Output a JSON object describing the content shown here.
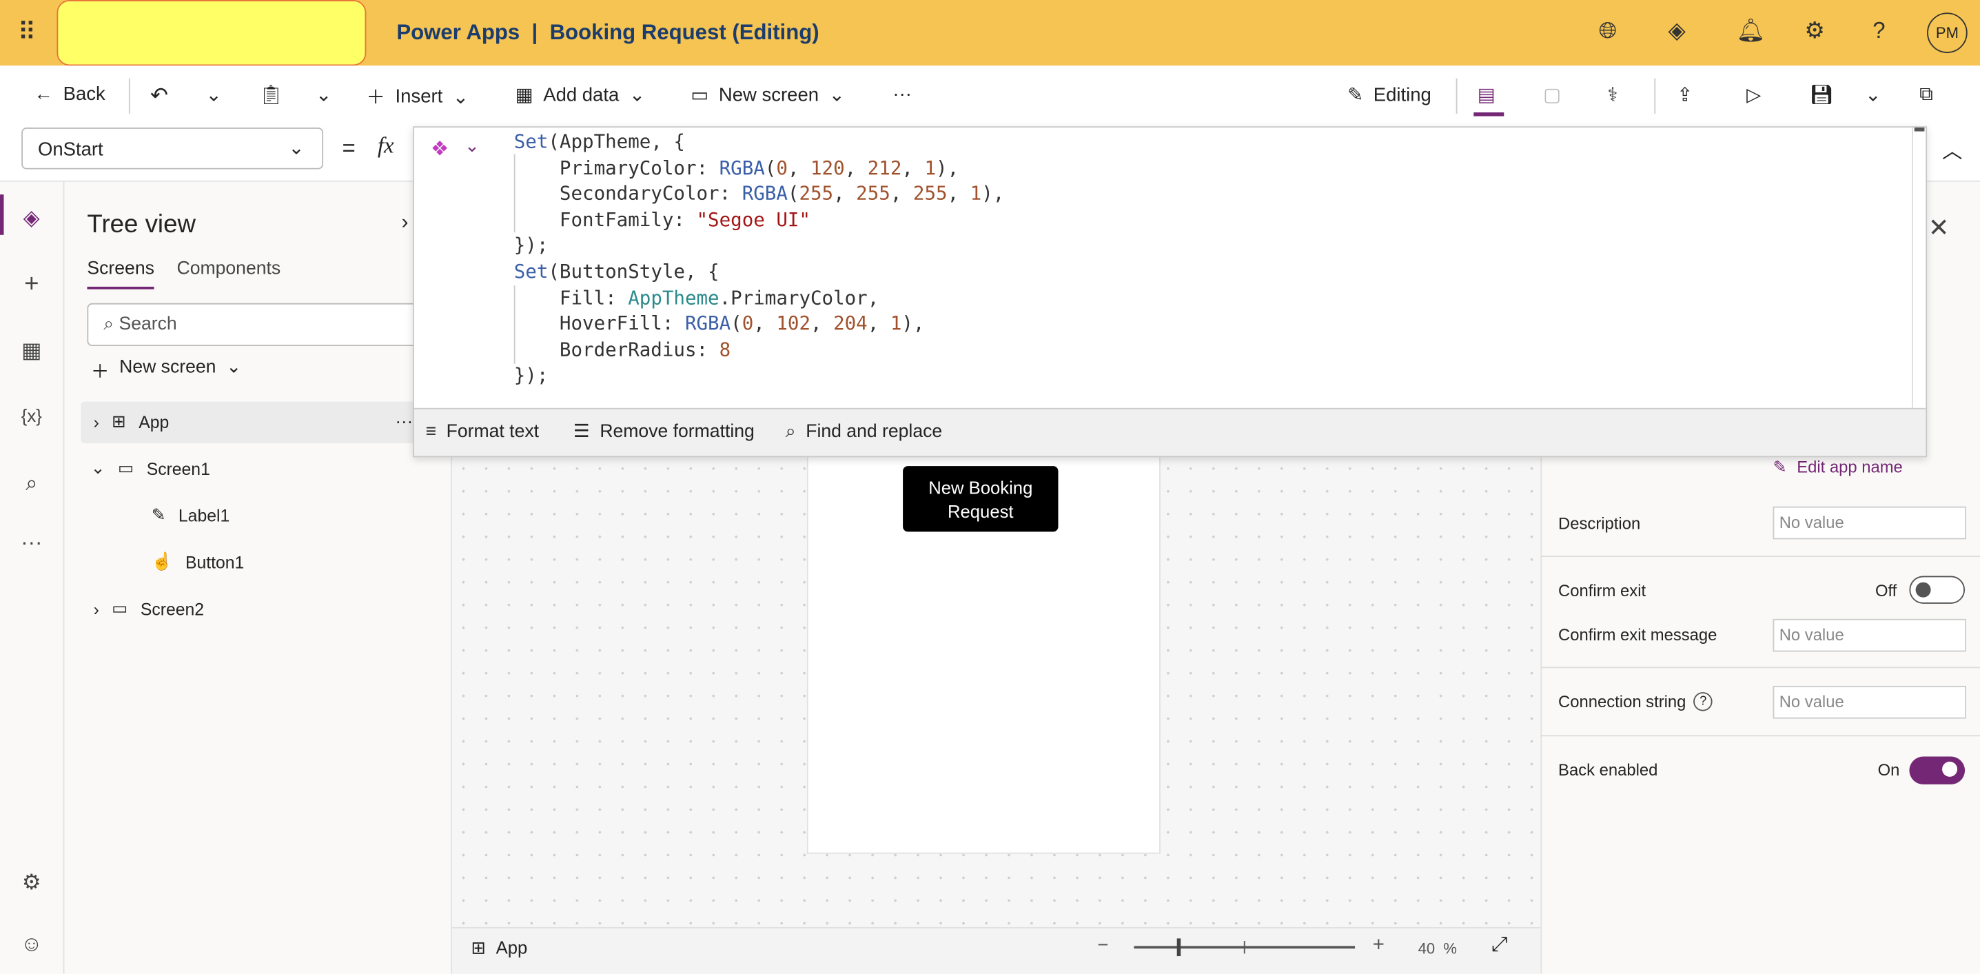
{
  "header": {
    "app_name": "Power Apps",
    "separator": "|",
    "doc_title": "Booking Request (Editing)",
    "avatar": "PM",
    "icons": [
      "waffle-icon",
      "globe-icon",
      "copilot-icon",
      "bell-icon",
      "gear-icon",
      "help-icon"
    ]
  },
  "toolbar": {
    "back": "Back",
    "insert": "Insert",
    "add_data": "Add data",
    "new_screen": "New screen",
    "more": "···",
    "editing": "Editing"
  },
  "formula": {
    "property": "OnStart",
    "equals": "=",
    "fx": "fx",
    "code": [
      [
        [
          "Set",
          "fn"
        ],
        [
          "(AppTheme, {",
          "p"
        ]
      ],
      [
        [
          "    PrimaryColor: ",
          "p"
        ],
        [
          "RGBA",
          "fn"
        ],
        [
          "(",
          "p"
        ],
        [
          "0",
          "num"
        ],
        [
          ", ",
          "p"
        ],
        [
          "120",
          "num"
        ],
        [
          ", ",
          "p"
        ],
        [
          "212",
          "num"
        ],
        [
          ", ",
          "p"
        ],
        [
          "1",
          "num"
        ],
        [
          "),",
          "p"
        ]
      ],
      [
        [
          "    SecondaryColor: ",
          "p"
        ],
        [
          "RGBA",
          "fn"
        ],
        [
          "(",
          "p"
        ],
        [
          "255",
          "num"
        ],
        [
          ", ",
          "p"
        ],
        [
          "255",
          "num"
        ],
        [
          ", ",
          "p"
        ],
        [
          "255",
          "num"
        ],
        [
          ", ",
          "p"
        ],
        [
          "1",
          "num"
        ],
        [
          "),",
          "p"
        ]
      ],
      [
        [
          "    FontFamily: ",
          "p"
        ],
        [
          "\"Segoe UI\"",
          "str"
        ]
      ],
      [
        [
          "});",
          "p"
        ]
      ],
      [
        [
          "Set",
          "fn"
        ],
        [
          "(ButtonStyle, {",
          "p"
        ]
      ],
      [
        [
          "    Fill: ",
          "p"
        ],
        [
          "AppTheme",
          "id"
        ],
        [
          ".PrimaryColor,",
          "p"
        ]
      ],
      [
        [
          "    HoverFill: ",
          "p"
        ],
        [
          "RGBA",
          "fn"
        ],
        [
          "(",
          "p"
        ],
        [
          "0",
          "num"
        ],
        [
          ", ",
          "p"
        ],
        [
          "102",
          "num"
        ],
        [
          ", ",
          "p"
        ],
        [
          "204",
          "num"
        ],
        [
          ", ",
          "p"
        ],
        [
          "1",
          "num"
        ],
        [
          "),",
          "p"
        ]
      ],
      [
        [
          "    BorderRadius: ",
          "p"
        ],
        [
          "8",
          "num"
        ]
      ],
      [
        [
          "});",
          "p"
        ]
      ]
    ],
    "footer": {
      "format": "Format text",
      "remove": "Remove formatting",
      "find": "Find and replace"
    }
  },
  "tree": {
    "title": "Tree view",
    "tabs": [
      "Screens",
      "Components"
    ],
    "search_placeholder": "Search",
    "new_screen": "New screen",
    "items": [
      {
        "label": "App"
      },
      {
        "label": "Screen1"
      },
      {
        "label": "Label1"
      },
      {
        "label": "Button1"
      },
      {
        "label": "Screen2"
      }
    ]
  },
  "canvas": {
    "button_text": "New Booking Request",
    "footer_label": "App",
    "zoom_minus": "−",
    "zoom_plus": "+",
    "zoom_value": "40",
    "zoom_unit": "%",
    "zoom_percent": 40
  },
  "properties": {
    "edit_app_name": "Edit app name",
    "description_label": "Description",
    "description_value": "No value",
    "confirm_exit_label": "Confirm exit",
    "confirm_exit_state": "Off",
    "confirm_exit_on": false,
    "confirm_msg_label": "Confirm exit message",
    "confirm_msg_value": "No value",
    "conn_label": "Connection string",
    "conn_value": "No value",
    "conn_help": "?",
    "back_label": "Back enabled",
    "back_state": "On",
    "back_on": true,
    "accent": "#742774"
  }
}
